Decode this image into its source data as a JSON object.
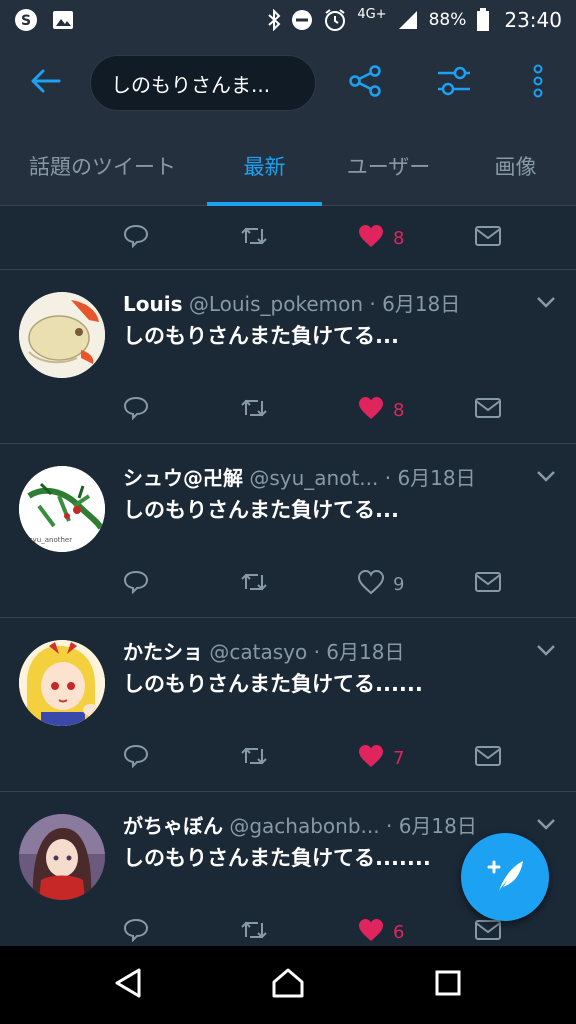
{
  "status_bar": {
    "network": "4G+",
    "battery": "88%",
    "time": "23:40"
  },
  "toolbar": {
    "search_query": "しのもりさんま...",
    "icons": [
      "back-arrow-icon",
      "share-icon",
      "filter-icon",
      "overflow-menu-icon"
    ]
  },
  "tabs": [
    {
      "label": "話題のツイート",
      "active": false
    },
    {
      "label": "最新",
      "active": true
    },
    {
      "label": "ユーザー",
      "active": false
    },
    {
      "label": "画像",
      "active": false
    }
  ],
  "top_partial": {
    "like_count": "8"
  },
  "tweets": [
    {
      "name": "Louis",
      "handle": "@Louis_pokemon",
      "sep": "·",
      "date": "6月18日",
      "text": "しのもりさんまた負けてる...",
      "like_count": "8",
      "liked": true
    },
    {
      "name": "シュウ@卍解",
      "handle": "@syu_anot...",
      "sep": "·",
      "date": "6月18日",
      "text": "しのもりさんまた負けてる...",
      "like_count": "9",
      "liked": false
    },
    {
      "name": "かたショ",
      "handle": "@catasyo",
      "sep": "·",
      "date": "6月18日",
      "text": "しのもりさんまた負けてる......",
      "like_count": "7",
      "liked": true
    },
    {
      "name": "がちゃぼん",
      "handle": "@gachabonb...",
      "sep": "·",
      "date": "6月18日",
      "text": "しのもりさんまた負けてる.......",
      "like_count": "6",
      "liked": true
    }
  ],
  "colors": {
    "accent": "#1da1f2",
    "like": "#e0245e",
    "background": "#1b2836",
    "bar": "#24303e"
  }
}
